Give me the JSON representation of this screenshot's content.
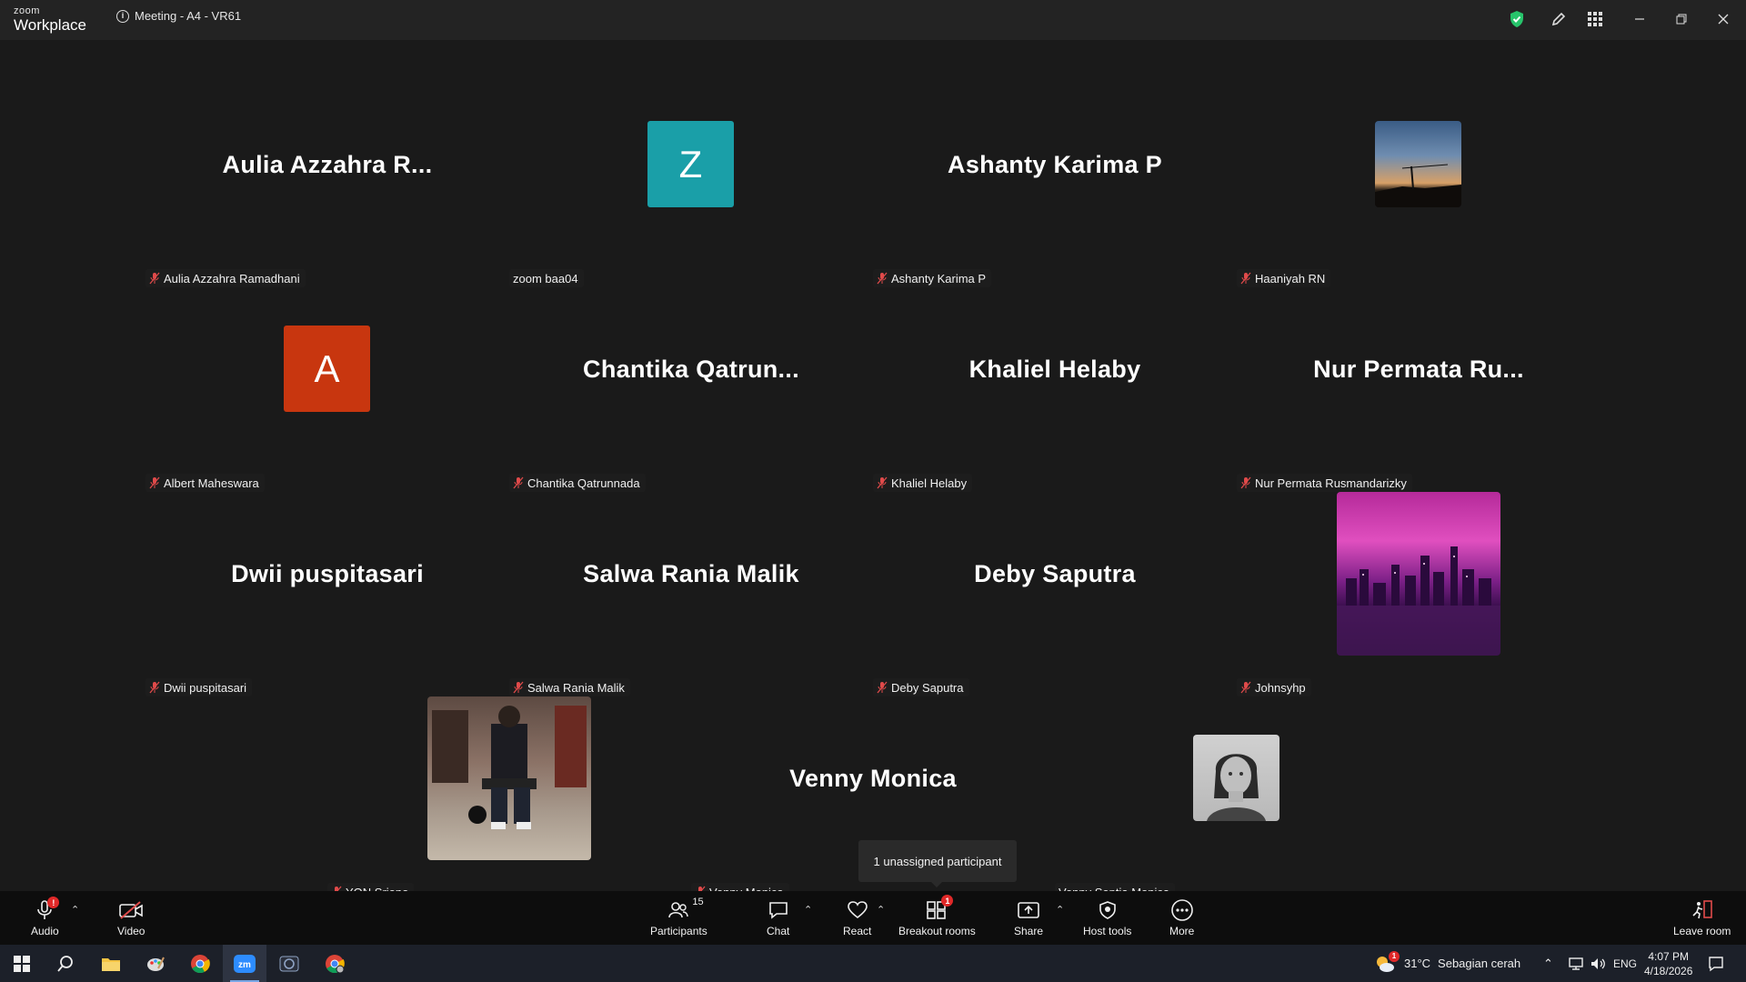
{
  "titlebar": {
    "logo_top": "zoom",
    "logo_bottom": "Workplace",
    "meeting_title": "Meeting - A4 - VR61"
  },
  "participants": [
    {
      "display": "Aulia  Azzahra  R...",
      "label": "Aulia Azzahra Ramadhani",
      "muted": true,
      "kind": "name"
    },
    {
      "display": "Z",
      "label": "zoom baa04",
      "muted": false,
      "kind": "letter",
      "color": "#1a9fa8"
    },
    {
      "display": "Ashanty Karima P",
      "label": "Ashanty Karima P",
      "muted": true,
      "kind": "name"
    },
    {
      "display": "",
      "label": "Haaniyah RN",
      "muted": true,
      "kind": "photo",
      "photo": "sunset-icon"
    },
    {
      "display": "A",
      "label": "Albert Maheswara",
      "muted": true,
      "kind": "letter",
      "color": "#c8360f"
    },
    {
      "display": "Chantika  Qatrun...",
      "label": "Chantika Qatrunnada",
      "muted": true,
      "kind": "name"
    },
    {
      "display": "Khaliel Helaby",
      "label": "Khaliel Helaby",
      "muted": true,
      "kind": "name"
    },
    {
      "display": "Nur  Permata  Ru...",
      "label": "Nur Permata Rusmandarizky",
      "muted": true,
      "kind": "name"
    },
    {
      "display": "Dwii puspitasari",
      "label": "Dwii puspitasari",
      "muted": true,
      "kind": "name"
    },
    {
      "display": "Salwa Rania Malik",
      "label": "Salwa Rania Malik",
      "muted": true,
      "kind": "name"
    },
    {
      "display": "Deby Saputra",
      "label": "Deby Saputra",
      "muted": true,
      "kind": "name"
    },
    {
      "display": "",
      "label": "Johnsyhp",
      "muted": true,
      "kind": "photo",
      "photo": "city-night-icon"
    },
    {
      "display": "",
      "label": "YON Sriono",
      "muted": true,
      "kind": "photo",
      "photo": "gym-photo-icon"
    },
    {
      "display": "Venny Monica",
      "label": "Venny Monica",
      "muted": true,
      "kind": "name"
    },
    {
      "display": "",
      "label": "Venny Septia Monica",
      "muted": false,
      "kind": "photo",
      "photo": "portrait-icon"
    }
  ],
  "tooltip": "1 unassigned participant",
  "toolbar": {
    "audio": "Audio",
    "video": "Video",
    "participants": "Participants",
    "participants_count": "15",
    "chat": "Chat",
    "react": "React",
    "breakout": "Breakout rooms",
    "breakout_badge": "1",
    "share": "Share",
    "host_tools": "Host tools",
    "more": "More",
    "leave": "Leave room",
    "audio_badge": "!"
  },
  "taskbar": {
    "temperature": "31°C",
    "weather": "Sebagian cerah",
    "lang": "ENG",
    "time": "4:07 PM",
    "date": "4/18/2026",
    "weather_badge": "1"
  },
  "colors": {
    "accent_green": "#27c46b",
    "muted_red": "#e04a4a",
    "avatar_z": "#1a9fa8",
    "avatar_a": "#c8360f"
  }
}
